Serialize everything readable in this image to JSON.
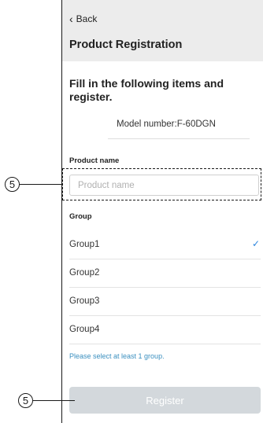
{
  "header": {
    "back_label": "Back",
    "title": "Product Registration"
  },
  "instruction": "Fill in the following items and register.",
  "model_number": "Model number:F-60DGN",
  "product_name": {
    "label": "Product name",
    "placeholder": "Product name",
    "value": ""
  },
  "group": {
    "label": "Group",
    "items": [
      {
        "label": "Group1",
        "selected": true
      },
      {
        "label": "Group2",
        "selected": false
      },
      {
        "label": "Group3",
        "selected": false
      },
      {
        "label": "Group4",
        "selected": false
      }
    ],
    "hint": "Please select at least 1 group."
  },
  "register_label": "Register",
  "callouts": {
    "input_callout": "5",
    "register_callout": "5"
  },
  "colors": {
    "header_bg": "#ececec",
    "check": "#2e86de",
    "hint": "#3a8fbf",
    "register_disabled": "#d3d8dc"
  }
}
